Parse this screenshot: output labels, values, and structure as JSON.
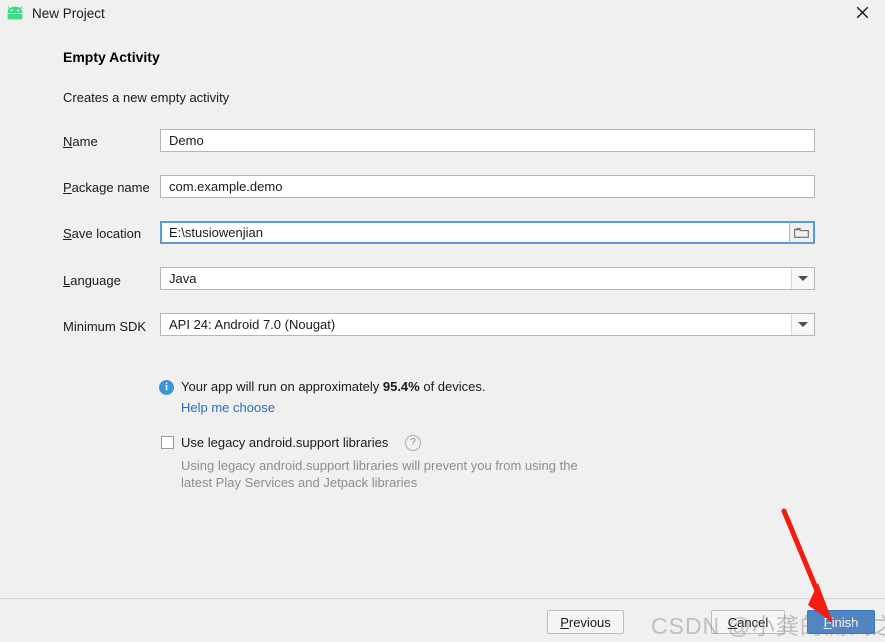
{
  "window": {
    "title": "New Project",
    "app_icon": "android-robot-icon",
    "close_icon": "close-icon"
  },
  "main": {
    "heading": "Empty Activity",
    "subheading": "Creates a new empty activity",
    "fields": [
      {
        "label_prefix": "",
        "label_mnemonic": "N",
        "label_suffix": "ame",
        "label_full": "Name",
        "value": "Demo",
        "type": "text"
      },
      {
        "label_prefix": "",
        "label_mnemonic": "P",
        "label_suffix": "ackage name",
        "label_full": "Package name",
        "value": "com.example.demo",
        "type": "text"
      },
      {
        "label_prefix": "",
        "label_mnemonic": "S",
        "label_suffix": "ave location",
        "label_full": "Save location",
        "value": "E:\\stusiowenjian",
        "type": "text-browse",
        "browse_icon": "folder-icon",
        "focused": true
      },
      {
        "label_prefix": "",
        "label_mnemonic": "L",
        "label_suffix": "anguage",
        "label_full": "Language",
        "value": "Java",
        "type": "combo"
      },
      {
        "label_prefix": "Minimum SDK",
        "label_mnemonic": "",
        "label_suffix": "",
        "label_full": "Minimum SDK",
        "value": "API 24: Android 7.0 (Nougat)",
        "type": "combo"
      }
    ],
    "info": {
      "icon": "info-icon",
      "text_before": "Your app will run on approximately ",
      "percent": "95.4%",
      "text_after": " of devices.",
      "link": "Help me choose"
    },
    "legacy": {
      "checkbox_label": "Use legacy android.support libraries",
      "checked": false,
      "help_icon": "question-mark-icon",
      "description": "Using legacy android.support libraries will prevent you from using the latest Play Services and Jetpack libraries"
    }
  },
  "footer": {
    "previous": {
      "prefix": "",
      "mnemonic": "P",
      "suffix": "revious",
      "full": "Previous"
    },
    "cancel": {
      "prefix": "",
      "mnemonic": "C",
      "suffix": "ancel",
      "full": "Cancel"
    },
    "finish": {
      "prefix": "",
      "mnemonic": "F",
      "suffix": "inish",
      "full": "Finish"
    }
  },
  "overlay": {
    "watermark": "CSDN @小龚的测试之路",
    "annotation_arrow": "red-arrow-pointing-to-finish"
  },
  "colors": {
    "accent_blue": "#4a86c8",
    "focus_blue": "#5b9bd5",
    "link_blue": "#2a6ebb",
    "info_blue": "#3a97d4",
    "android_green": "#3ddc84",
    "arrow_red": "#f51b0e",
    "dialog_bg": "#f0f0f0"
  }
}
